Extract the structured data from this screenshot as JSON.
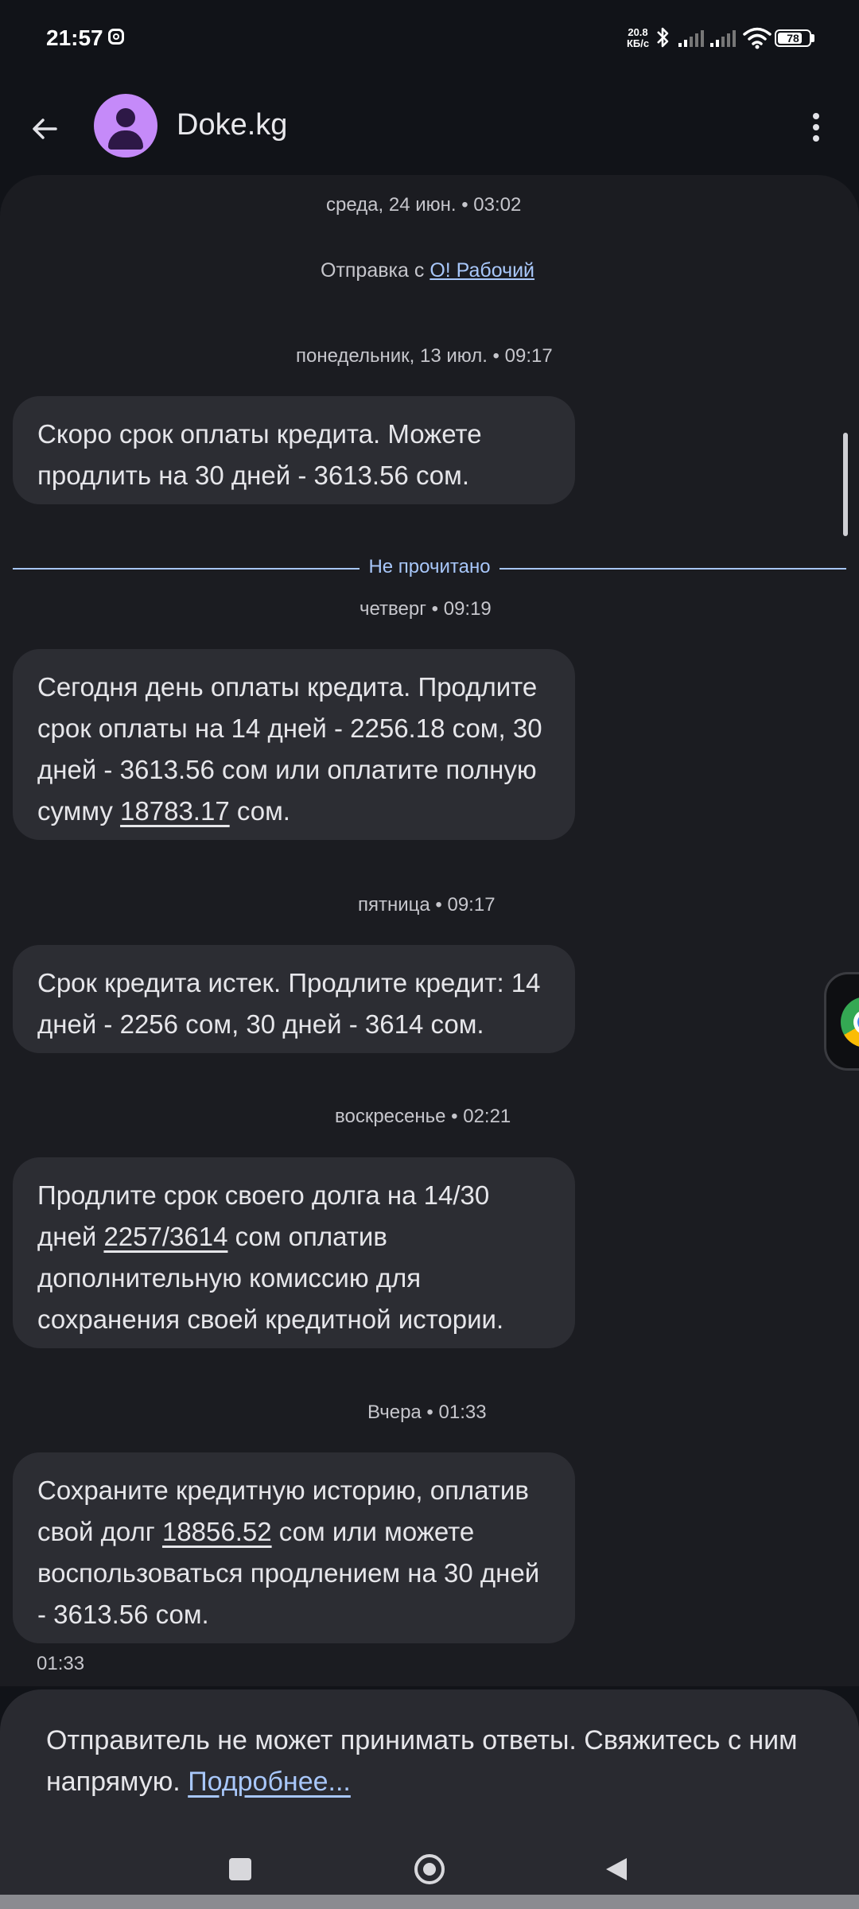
{
  "status_bar": {
    "time": "21:57",
    "net_speed_value": "20.8",
    "net_speed_unit": "КБ/с",
    "battery": "78",
    "battery_level": 0.78
  },
  "app_bar": {
    "contact_name": "Doke.kg",
    "avatar_color": "#c58af9",
    "back_icon": "arrow-back-icon",
    "menu_icon": "more-vert-icon"
  },
  "conversation": {
    "header_timestamp": "среда, 24 июн. • 03:02",
    "sim_info_prefix": "Отправка с ",
    "sim_info_link": "О! Рабочий",
    "unread_label": "Не прочитано",
    "messages": [
      {
        "timestamp": "понедельник, 13 июл. • 09:17",
        "parts": [
          "Скоро срок оплаты кредита. Можете продлить на 30 дней - 3613.56 сом."
        ]
      },
      {
        "timestamp": "четверг • 09:19",
        "parts": [
          "Сегодня день оплаты кредита. Продлите срок оплаты на 14 дней - 2256.18 сом, 30 дней - 3613.56 сом или оплатите полную сумму ",
          "18783.17",
          " сом."
        ]
      },
      {
        "timestamp": "пятница • 09:17",
        "parts": [
          "Срок кредита истек. Продлите кредит: 14 дней - 2256 сом, 30 дней - 3614 сом."
        ]
      },
      {
        "timestamp": "воскресенье • 02:21",
        "parts": [
          "Продлите срок своего долга на 14/30 дней ",
          "2257/3614",
          " сом оплатив дополнительную комиссию для сохранения своей кредитной истории."
        ]
      },
      {
        "timestamp": "Вчера • 01:33",
        "parts": [
          "Сохраните кредитную историю, оплатив свой долг ",
          "18856.52",
          " сом или можете воспользоваться продлением на 30 дней - 3613.56  сом."
        ],
        "time_below": "01:33"
      }
    ]
  },
  "bottom_notice": {
    "text": "Отправитель не может принимать ответы. Свяжитесь с ним напрямую. ",
    "link": "Подробнее..."
  },
  "colors": {
    "background": "#111318",
    "panel": "#1b1c21",
    "bubble": "#2c2d33",
    "accent_link": "#a8c7fa"
  }
}
